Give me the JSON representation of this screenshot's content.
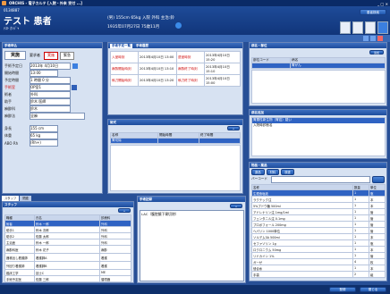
{
  "window_title": "ORCHIS - 電子カルテ  [入院・外来 受付 ...]",
  "patient": {
    "id": "0134887",
    "name": "テスト 患者",
    "kana": "ﾃｽﾄ ｶﾝｼﾞｬ",
    "info_line1": "(男) 155cm 65kg 入院 外科 主治:鈴",
    "info_line2": "1935年07月27日 75歳11月"
  },
  "top_right": {
    "badge": "患者検索"
  },
  "toolbar": {
    "icons": [
      "save-icon",
      "print-icon",
      "edit-icon",
      "help-icon"
    ]
  },
  "left_panel": {
    "header": "手術申込",
    "status_buttons": [
      "実施",
      "実施",
      "緊急"
    ],
    "fields": [
      {
        "label": "手術予定日",
        "value": "2013年 4月10日"
      },
      {
        "label": "開始時間",
        "value": "13:00"
      },
      {
        "label": "予定時間",
        "value": "1 時間 0 分"
      },
      {
        "label": "手術室",
        "value": "OP室1"
      },
      {
        "label": "術者",
        "value": "外科"
      },
      {
        "label": "助手",
        "value": "鈴木 医師"
      },
      {
        "label": "麻酔科",
        "value": "鈴木"
      },
      {
        "label": "麻酔法",
        "value": "全麻"
      },
      {
        "label": "身長",
        "value": "155 cm"
      },
      {
        "label": "体重",
        "value": "65 kg"
      },
      {
        "label": "ABO Rh",
        "value": "(Rh+)"
      }
    ]
  },
  "center_top": {
    "tabs": [
      "手術予定一覧",
      "手術履歴"
    ],
    "rows": [
      {
        "k1": "入室時刻",
        "v1": "2013年4月10日 13:00",
        "k2": "退室時刻",
        "v2": "2013年4月10日 15:20"
      },
      {
        "k1": "麻酔開始時刻",
        "v1": "2013年4月10日 13:10",
        "k2": "麻酔終了時刻",
        "v2": "2013年4月10日 15:10"
      },
      {
        "k1": "執刀開始時刻",
        "v1": "2013年4月10日 13:20",
        "k2": "執刀終了時刻",
        "v2": "2013年4月10日 15:00"
      }
    ]
  },
  "center_mid": {
    "header": "術式",
    "columns": [
      "名称",
      "開始時間",
      "終了時間"
    ],
    "rows": [
      [
        "胃切除",
        "",
        ""
      ]
    ]
  },
  "right_top": {
    "header": "病名・部位",
    "button": "追加",
    "list": [
      {
        "code": "部位コード",
        "name": "病名"
      },
      {
        "code": "",
        "name": "胃がん"
      }
    ]
  },
  "right_mid": {
    "header": "病名追加",
    "items": [
      "胃悪性新生物（胃癌）疑い",
      "入院時診断名"
    ]
  },
  "right_bottom": {
    "header": "物品・薬品",
    "tabs": [
      "薬品",
      "材料",
      "検査"
    ],
    "search_label": "バーコード",
    "search_value": "",
    "columns": [
      "名称",
      "数量",
      "単位"
    ],
    "rows": [
      [
        "生理食塩液",
        "1",
        "瓶"
      ],
      [
        "ラクテック注",
        "1",
        "本"
      ],
      [
        "5%ブドウ糖 500ml",
        "1",
        "本"
      ],
      [
        "アドレナリン注 1mg/1ml",
        "1",
        "管"
      ],
      [
        "フェンタニル注 0.1mg",
        "1",
        "管"
      ],
      [
        "プロポフォール 200mg",
        "1",
        "管"
      ],
      [
        "ヘパリン 1000単位",
        "1",
        "管"
      ],
      [
        "ソルデム3A 500ml",
        "1",
        "本"
      ],
      [
        "セファゾリン 1g",
        "1",
        "瓶"
      ],
      [
        "ロクロニウム 50mg",
        "1",
        "本"
      ],
      [
        "リドカイン 1%",
        "1",
        "管"
      ],
      [
        "ガーゼ",
        "4",
        "枚"
      ],
      [
        "縫合糸",
        "1",
        "本"
      ],
      [
        "手袋",
        "2",
        "組"
      ]
    ]
  },
  "left_bottom": {
    "tabs": [
      "スタッフ",
      "関連"
    ],
    "header": "スタッフ",
    "columns": [
      "職種",
      "氏名",
      "診療科"
    ],
    "rows": [
      [
        "術者",
        "鈴木 一郎",
        "外科"
      ],
      [
        "助手1",
        "鈴木 次郎",
        "外科"
      ],
      [
        "助手2",
        "佐藤 太郎",
        "外科"
      ],
      [
        "主治医",
        "鈴木 一郎",
        "外科"
      ],
      [
        "麻酔科医",
        "鈴木 花子",
        "麻酔"
      ],
      [
        "器械出し看護師",
        "看護師A",
        "看護"
      ],
      [
        "外回り看護師",
        "看護師B",
        "看護"
      ],
      [
        "臨床工学",
        "技士C",
        "ME"
      ],
      [
        "手術予定医",
        "佐藤 三郎",
        "循環器"
      ]
    ]
  },
  "center_bottom": {
    "header": "手術記録",
    "text": "LAC（腹腔鏡下胃切除）"
  },
  "footer": {
    "buttons": [
      "登録",
      "閉じる"
    ]
  }
}
